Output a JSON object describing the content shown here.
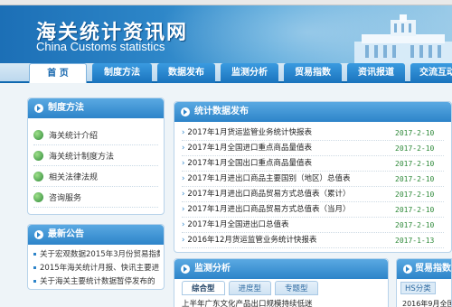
{
  "banner": {
    "title_cn": "海关统计资讯网",
    "title_en": "China Customs statistics"
  },
  "nav": {
    "tabs": [
      "首 页",
      "制度方法",
      "数据发布",
      "监测分析",
      "贸易指数",
      "资讯报道",
      "交流互动"
    ],
    "active_index": 0
  },
  "methods": {
    "title": "制度方法",
    "items": [
      "海关统计介绍",
      "海关统计制度方法",
      "相关法律法规",
      "咨询服务"
    ]
  },
  "announcements": {
    "title": "最新公告",
    "items": [
      "关于宏观数据2015年3月份贸易指数",
      "2015年海关统计月报、快讯主要进",
      "关于海关主要统计数据暂停发布的"
    ]
  },
  "stats_release": {
    "title": "统计数据发布",
    "rows": [
      {
        "title": "2017年1月货运监管业务统计快报表",
        "date": "2017-2-10"
      },
      {
        "title": "2017年1月全国进口重点商品量值表",
        "date": "2017-2-10"
      },
      {
        "title": "2017年1月全国出口重点商品量值表",
        "date": "2017-2-10"
      },
      {
        "title": "2017年1月进出口商品主要国别（地区）总值表",
        "date": "2017-2-10"
      },
      {
        "title": "2017年1月进出口商品贸易方式总值表（累计）",
        "date": "2017-2-10"
      },
      {
        "title": "2017年1月进出口商品贸易方式总值表（当月）",
        "date": "2017-2-10"
      },
      {
        "title": "2017年1月全国进出口总值表",
        "date": "2017-2-10"
      },
      {
        "title": "2016年12月货运监管业务统计快报表",
        "date": "2017-1-13"
      }
    ]
  },
  "monitor": {
    "title": "监测分析",
    "tabs": [
      "综合型",
      "进度型",
      "专题型"
    ],
    "item": "上半年广东文化产品出口规模持续低迷"
  },
  "trade_index": {
    "title": "贸易指数",
    "tab": "HS分类",
    "item": "2016年9月全国"
  },
  "colors": {
    "nav_blue": "#1a73bd",
    "date_green": "#2f8a3a",
    "panel_head": "#2d84c9"
  }
}
